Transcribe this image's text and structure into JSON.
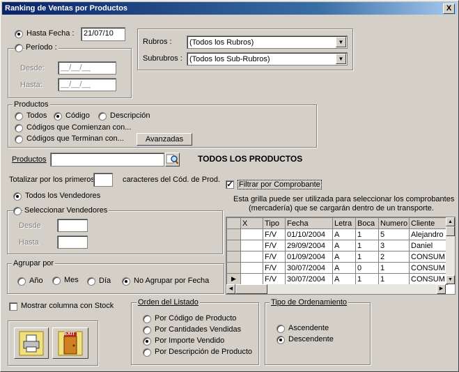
{
  "window": {
    "title": "Ranking de Ventas por Productos",
    "close_glyph": "X"
  },
  "fecha": {
    "hasta_label": "Hasta Fecha :",
    "hasta_value": "21/07/10",
    "periodo_label": "Período :",
    "desde_label": "Desde:",
    "desde_value": "__/__/__",
    "hasta2_label": "Hasta:",
    "hasta2_value": "__/__/__"
  },
  "rubros": {
    "rubros_label": "Rubros :",
    "rubros_value": "(Todos los Rubros)",
    "subrubros_label": "Subrubros :",
    "subrubros_value": "(Todos los Sub-Rubros)"
  },
  "productos_group": {
    "title": "Productos",
    "todos": "Todos",
    "codigo": "Código",
    "descripcion": "Descripción",
    "comienzan": "Códigos que Comienzan con...",
    "terminan": "Códigos que Terminan con...",
    "avanzadas": "Avanzadas"
  },
  "productos_field": {
    "label": "Productos",
    "value": "",
    "status": "TODOS LOS PRODUCTOS"
  },
  "totalizar": {
    "pre": "Totalizar por los primeros",
    "value": "",
    "post": "caracteres del Cód. de Prod."
  },
  "vendedores": {
    "todos": "Todos los Vendedores",
    "seleccionar": "Seleccionar Vendedores",
    "desde": "Desde",
    "hasta": "Hasta"
  },
  "agrupar": {
    "title": "Agrupar por",
    "anio": "Año",
    "mes": "Mes",
    "dia": "Día",
    "no_agrupar": "No Agrupar por Fecha"
  },
  "mostrar_stock": "Mostrar columna con Stock",
  "filtrar": {
    "label": "Filtrar por Comprobante",
    "checked": true,
    "info1": "Esta grilla puede ser utilizada para seleccionar los comprobantes",
    "info2": "(mercadería) que se cargarán dentro de un transporte."
  },
  "grid": {
    "columns": [
      "X",
      "Tipo",
      "Fecha",
      "Letra",
      "Boca",
      "Numero",
      "Cliente"
    ],
    "rows": [
      [
        "",
        "F/V",
        "01/10/2004",
        "A",
        "1",
        "5",
        "Alejandro"
      ],
      [
        "",
        "F/V",
        "29/09/2004",
        "A",
        "1",
        "3",
        "Daniel"
      ],
      [
        "",
        "F/V",
        "01/09/2004",
        "A",
        "1",
        "2",
        "CONSUM"
      ],
      [
        "",
        "F/V",
        "30/07/2004",
        "A",
        "0",
        "1",
        "CONSUM"
      ],
      [
        "",
        "F/V",
        "30/07/2004",
        "A",
        "1",
        "1",
        "CONSUM"
      ]
    ]
  },
  "orden": {
    "title": "Orden del Listado",
    "codigo": "Por Código de Producto",
    "cantidades": "Por Cantidades Vendidas",
    "importe": "Por Importe Vendido",
    "descripcion": "Por Descripción de Producto"
  },
  "tipo_orden": {
    "title": "Tipo de Ordenamiento",
    "ascendente": "Ascendente",
    "descendente": "Descendente"
  },
  "exit_label": "EXIT",
  "colors": {
    "face": "#d4d0c8",
    "title_start": "#0a246a",
    "title_end": "#a6caf0"
  }
}
